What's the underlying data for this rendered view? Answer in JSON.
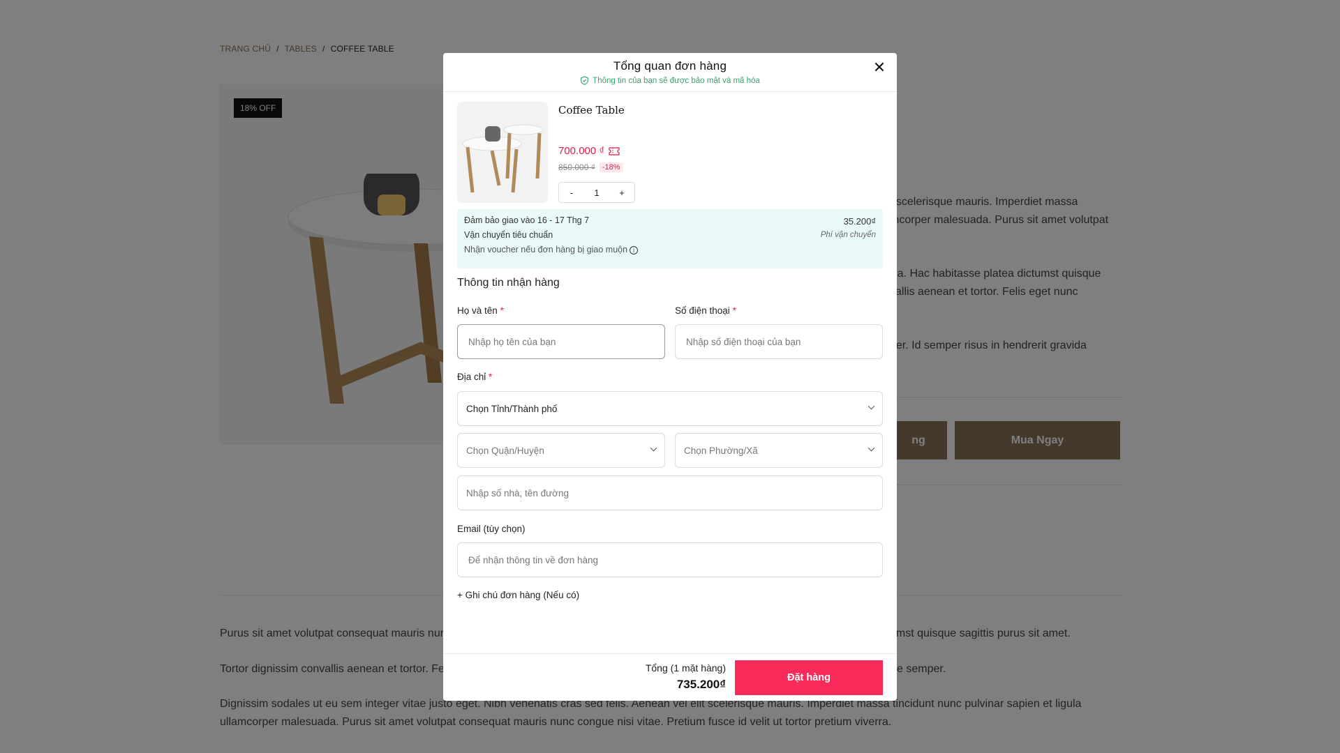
{
  "breadcrumb": {
    "home": "TRANG CHỦ",
    "category": "TABLES",
    "current": "COFFEE TABLE",
    "separator": "/"
  },
  "product_page": {
    "badge": "18% OFF",
    "desc_lines": [
      "t scelerisque mauris. Imperdiet massa",
      "mcorper malesuada. Purus sit amet volutpat",
      "rra. Hac habitasse platea dictumst quisque",
      "vallis aenean et tortor. Felis eget nunc",
      "per. Id semper risus in hendrerit gravida"
    ],
    "add_to_cart_partial": "ng",
    "buy_now": "Mua Ngay",
    "paragraphs": [
      "Purus sit amet volutpat consequat mauris nur",
      "umst quisque sagittis purus sit amet.",
      "Tortor dignissim convallis aenean et tortor. Fe",
      "e semper.",
      "Dignissim sodales ut eu sem integer vitae justo eget. Nibh venenatis cras sed felis. Aenean vel elit scelerisque mauris. Imperdiet massa tincidunt nunc pulvinar sapien et ligula",
      "ullamcorper malesuada. Purus sit amet volutpat consequat mauris nunc congue nisi vitae. Pretium fusce id velit ut tortor pretium viverra."
    ]
  },
  "modal": {
    "title": "Tổng quan đơn hàng",
    "secure_note": "Thông tin của bạn sẽ được bảo mật và mã hóa",
    "close_icon": "close-icon",
    "product": {
      "name": "Coffee Table",
      "price": "700.000 ₫",
      "old_price": "850.000 ₫",
      "discount": "-18%",
      "qty_minus": "-",
      "qty": "1",
      "qty_plus": "+"
    },
    "shipping": {
      "guarantee": "Đảm bảo giao vào 16 - 17 Thg 7",
      "method": "Vận chuyển tiêu chuẩn",
      "voucher": "Nhận voucher nếu đơn hàng bị giao muộn",
      "fee": "35.200₫",
      "fee_label": "Phí vận chuyển"
    },
    "section_title": "Thông tin nhận hàng",
    "fields": {
      "name_label": "Họ và tên",
      "name_placeholder": "Nhập họ tên của bạn",
      "phone_label": "Số điện thoại",
      "phone_placeholder": "Nhập số điện thoại của bạn",
      "address_label": "Địa chỉ",
      "province": "Chọn Tỉnh/Thành phố",
      "district": "Chọn Quận/Huyện",
      "ward": "Chọn Phường/Xã",
      "street_placeholder": "Nhập số nhà, tên đường",
      "email_label": "Email (tùy chọn)",
      "email_placeholder": "Để nhận thông tin về đơn hàng",
      "required_mark": "*"
    },
    "note_link": "+ Ghi chú đơn hàng (Nếu có)",
    "footer": {
      "total_label": "Tổng (1 mặt hàng)",
      "total_value": "735.200₫",
      "order_button": "Đặt hàng"
    }
  },
  "colors": {
    "accent": "#f72a5a",
    "brand": "#8b7358",
    "secure": "#38a169",
    "price": "#e11d48"
  }
}
